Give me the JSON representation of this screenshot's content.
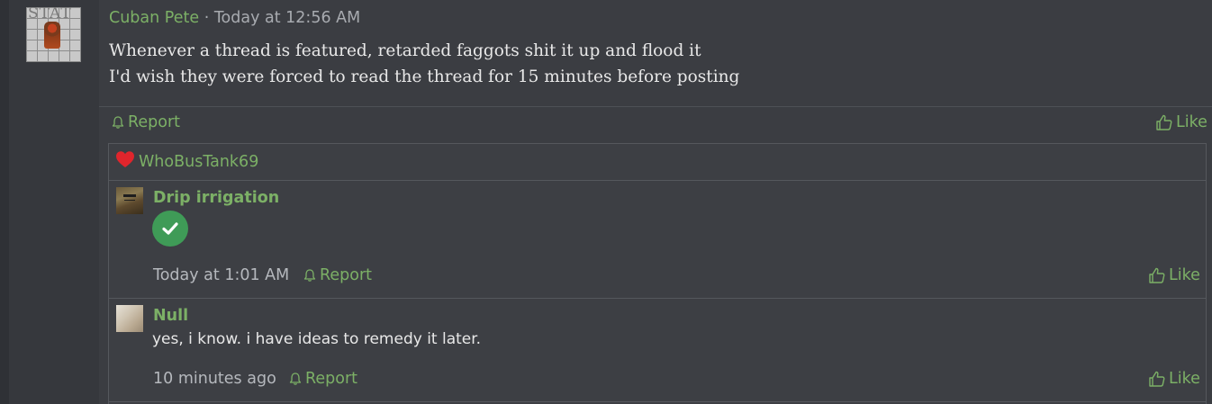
{
  "post": {
    "author": "Cuban Pete",
    "time_sep": " · ",
    "time": "Today at 12:56 AM",
    "avatar_text": "STAT",
    "lines": [
      "Whenever a thread is featured, retarded faggots shit it up and flood it",
      "I'd wish they were forced to read the thread for 15 minutes before posting"
    ],
    "report_label": "Report",
    "like_label": "Like"
  },
  "reactions": {
    "icon": "heart-icon",
    "users": "WhoBusTank69"
  },
  "replies": [
    {
      "author": "Drip irrigation",
      "content_icon": "checkmark-icon",
      "time": "Today at 1:01 AM",
      "report_label": "Report",
      "like_label": "Like"
    },
    {
      "author": "Null",
      "text": "yes, i know. i have ideas to remedy it later.",
      "time": "10 minutes ago",
      "report_label": "Report",
      "like_label": "Like"
    }
  ],
  "colors": {
    "accent": "#7cb066",
    "background": "#3b3d42",
    "heart": "#e0252c",
    "check": "#3f9b57"
  }
}
